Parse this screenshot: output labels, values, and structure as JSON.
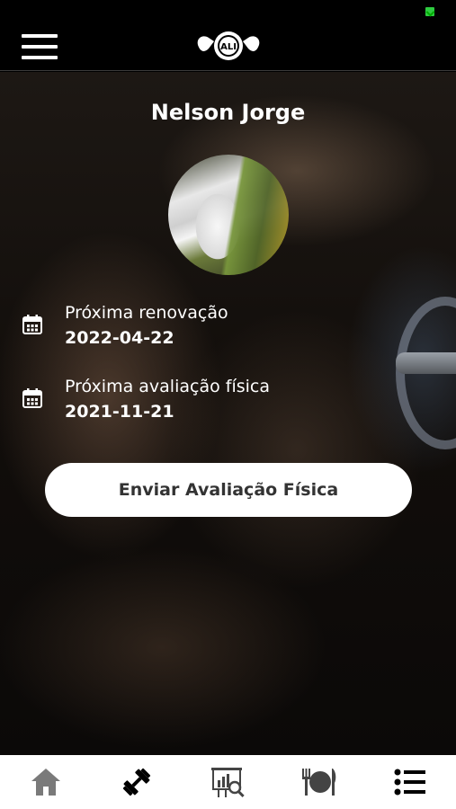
{
  "header": {
    "menu_icon": "hamburger-menu-icon",
    "logo_text": "ALI",
    "logo_icon": "gym-logo-icon"
  },
  "profile": {
    "name": "Nelson Jorge",
    "avatar_icon": "profile-photo"
  },
  "info": [
    {
      "icon": "calendar-icon",
      "label": "Próxima renovação",
      "value": "2022-04-22"
    },
    {
      "icon": "calendar-icon",
      "label": "Próxima avaliação física",
      "value": "2021-11-21"
    }
  ],
  "actions": {
    "send_assessment_label": "Enviar Avaliação Física"
  },
  "bottom_nav": {
    "items": [
      {
        "icon": "home-icon",
        "active": false
      },
      {
        "icon": "dumbbell-icon",
        "active": true
      },
      {
        "icon": "assessment-chart-icon",
        "active": false
      },
      {
        "icon": "nutrition-icon",
        "active": false
      },
      {
        "icon": "list-icon",
        "active": false
      }
    ]
  },
  "colors": {
    "header_bg": "#000000",
    "text": "#ffffff",
    "button_bg": "#ffffff",
    "button_text": "#333333",
    "nav_active": "#000000",
    "nav_inactive": "#7a7a7a"
  }
}
